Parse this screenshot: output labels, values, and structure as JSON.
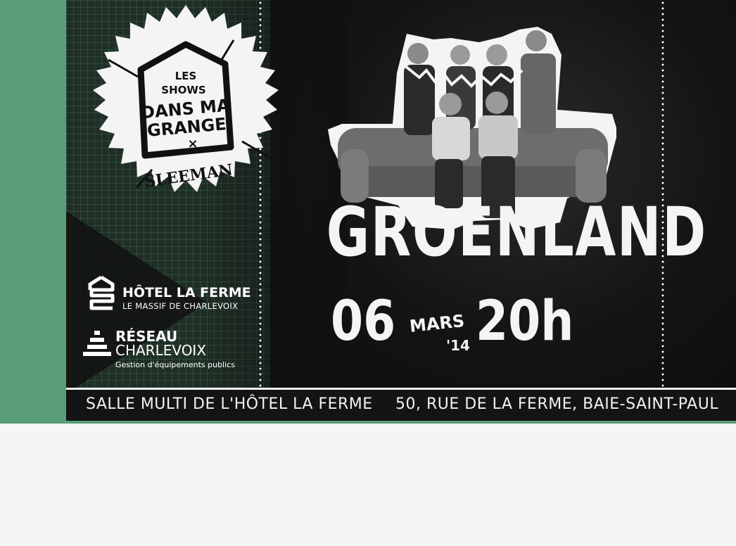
{
  "badge": {
    "line1": "LES",
    "line2": "SHOWS",
    "line3": "DANS MA",
    "line4": "GRANGE",
    "line5": "×",
    "line6": "SLEEMAN"
  },
  "event": {
    "band": "GROENLAND",
    "day": "06",
    "month": "MARS",
    "year": "'14",
    "time": "20h"
  },
  "sponsors": {
    "hotel_name": "HÔTEL LA FERME",
    "hotel_sub": "LE MASSIF DE CHARLEVOIX",
    "reseau_line1": "RÉSEAU",
    "reseau_line2": "CHARLEVOIX",
    "reseau_sub": "Gestion d'équipements publics"
  },
  "footer": {
    "venue": "SALLE MULTI DE L'HÔTEL LA FERME",
    "address": "50, RUE DE LA FERME, BAIE-SAINT-PAUL"
  },
  "colors": {
    "green": "#5a9e78",
    "dark": "#111111",
    "text": "#f4f4f4"
  }
}
